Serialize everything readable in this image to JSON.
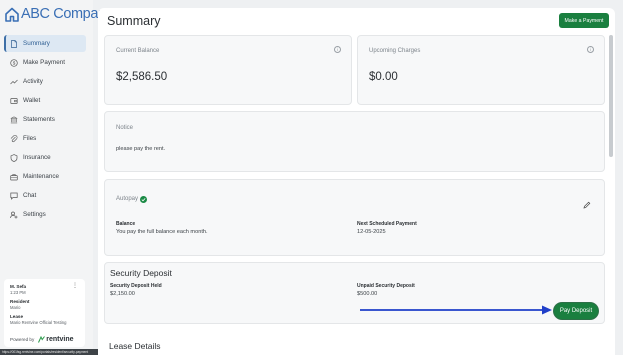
{
  "brand": {
    "name": "ABC Company",
    "color": "#3a6fb5"
  },
  "sidebar": {
    "items": [
      {
        "label": "Summary",
        "icon": "document-icon",
        "active": true
      },
      {
        "label": "Make Payment",
        "icon": "dollar-circle-icon"
      },
      {
        "label": "Activity",
        "icon": "trend-line-icon"
      },
      {
        "label": "Wallet",
        "icon": "wallet-icon"
      },
      {
        "label": "Statements",
        "icon": "bank-icon"
      },
      {
        "label": "Files",
        "icon": "paperclip-icon"
      },
      {
        "label": "Insurance",
        "icon": "shield-icon"
      },
      {
        "label": "Maintenance",
        "icon": "toolbox-icon"
      },
      {
        "label": "Chat",
        "icon": "chat-icon"
      },
      {
        "label": "Settings",
        "icon": "user-settings-icon"
      }
    ]
  },
  "user_card": {
    "name": "M. Sefa",
    "time": "1:23 PM",
    "role_label": "Resident",
    "role_value": "Mario",
    "lease_label": "Lease",
    "lease_value": "Mario Rentvine Official Testing",
    "powered_label": "Powered by",
    "powered_brand": "rentvine"
  },
  "status_url": "https://001fsg.rentvine.com/portals/resident/security-payment",
  "main": {
    "title": "Summary",
    "make_payment_label": "Make a Payment",
    "current_balance": {
      "label": "Current Balance",
      "value": "$2,586.50"
    },
    "upcoming_charges": {
      "label": "Upcoming Charges",
      "value": "$0.00"
    },
    "notice": {
      "label": "Notice",
      "text": "please pay the rent."
    },
    "autopay": {
      "label": "Autopay",
      "balance_label": "Balance",
      "balance_text": "You pay the full balance each month.",
      "next_label": "Next Scheduled Payment",
      "next_value": "12-05-2025"
    },
    "security_deposit": {
      "title": "Security Deposit",
      "held_label": "Security Deposit Held",
      "held_value": "$2,150.00",
      "unpaid_label": "Unpaid Security Deposit",
      "unpaid_value": "$500.00",
      "pay_label": "Pay Deposit"
    },
    "lease_details": {
      "title": "Lease Details"
    }
  },
  "colors": {
    "accent": "#1a7f3f",
    "arrow": "#1f3fc9",
    "active_nav": "#dde8f3"
  }
}
